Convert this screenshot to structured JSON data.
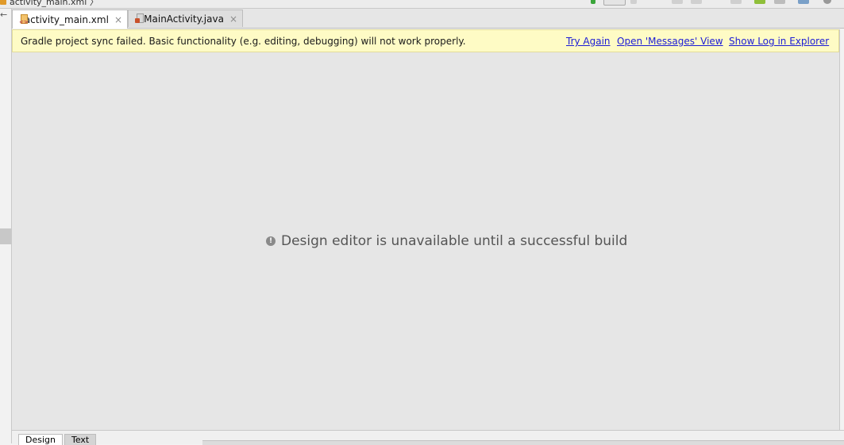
{
  "breadcrumb": {
    "file": "activity_main.xml",
    "separator": "〉"
  },
  "toolbar": {
    "icons": [
      "run-icon",
      "device-selector",
      "play-icon",
      "debug-icon",
      "sync-icon",
      "android-icon",
      "sdk-manager-icon",
      "search-icon"
    ]
  },
  "gutter": {
    "arrow": "←"
  },
  "tabs": [
    {
      "label": "activity_main.xml",
      "icon": "xml-file-icon",
      "active": true,
      "close": "×"
    },
    {
      "label": "MainActivity.java",
      "icon": "java-file-icon",
      "active": false,
      "close": "×"
    }
  ],
  "banner": {
    "message": "Gradle project sync failed. Basic functionality (e.g. editing, debugging) will not work properly.",
    "links": [
      "Try Again",
      "Open 'Messages' View",
      "Show Log in Explorer"
    ]
  },
  "canvas": {
    "message": "Design editor is unavailable until a successful build",
    "info_glyph": "!"
  },
  "bottom_tabs": [
    {
      "label": "Design",
      "active": true
    },
    {
      "label": "Text",
      "active": false
    }
  ],
  "colors": {
    "banner_bg": "#fefbc5",
    "link": "#1b1bd6",
    "canvas_bg": "#e6e6e6"
  }
}
